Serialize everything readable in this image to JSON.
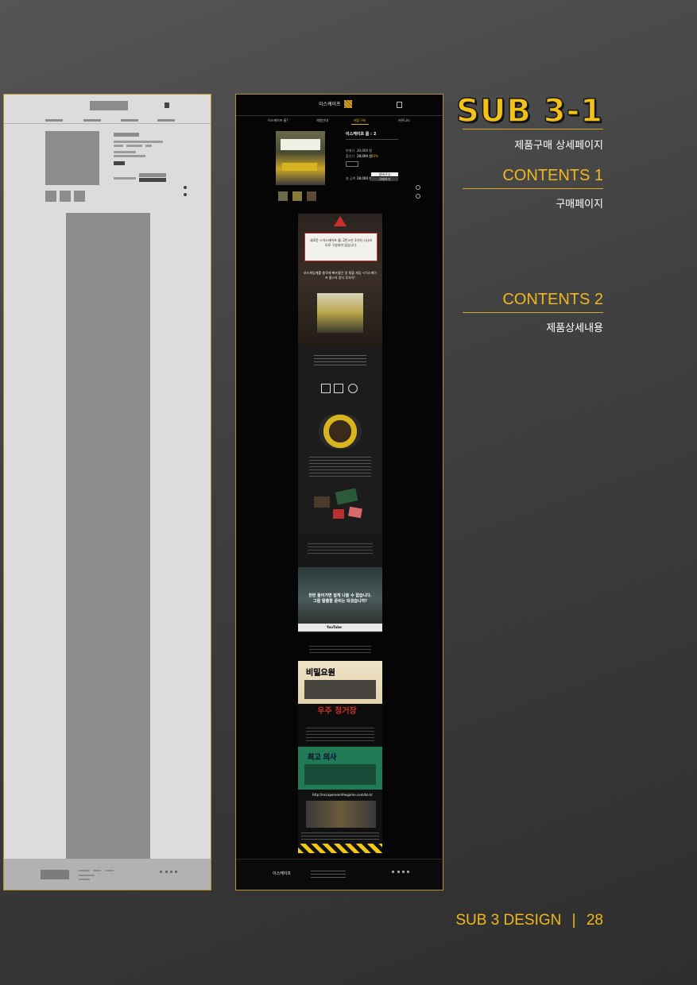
{
  "page": {
    "title": "SUB 3-1",
    "subtitle": "제품구매 상세페이지",
    "contents": [
      {
        "heading": "CONTENTS 1",
        "desc": "구매페이지"
      },
      {
        "heading": "CONTENTS 2",
        "desc": "제품상세내용"
      }
    ],
    "footer": {
      "section": "SUB 3 DESIGN",
      "separator": "|",
      "page_number": "28"
    }
  },
  "design": {
    "logo": "이스케이프",
    "nav": [
      "이스케이프 룸?",
      "체험안내",
      "제품구매",
      "커뮤니티"
    ],
    "product": {
      "name": "이스케이프 룸 : 2",
      "price_label_1": "판매가",
      "price_value_1": "30,000 원",
      "price_label_2": "할인가",
      "price_value_2": "28,000 원",
      "discount": "10%",
      "total_label": "총 금액",
      "total_value": "28,000 원",
      "button_cart": "장바구니",
      "button_buy": "구매하기"
    },
    "notice": "새로운 <이스케이프 룸: 2탄>은 3가지 시나리오로 구성되어 있습니다.",
    "promo_title": "보드게임계를 충격에 빠뜨렸던 방 탈출 게임 <이스케이프 룸>의 정식 후속작!",
    "video_headline_1": "한번 들어가면 쉽게 나올 수 없습니다.",
    "video_headline_2": "그럼 탈출할 준비는 되셨습니까?",
    "youtube": "YouTube",
    "scenarios": [
      "비밀요원",
      "우주 정거장",
      "최고 의사"
    ],
    "url": "http://escaperoomthegame.com/ko-kr"
  }
}
